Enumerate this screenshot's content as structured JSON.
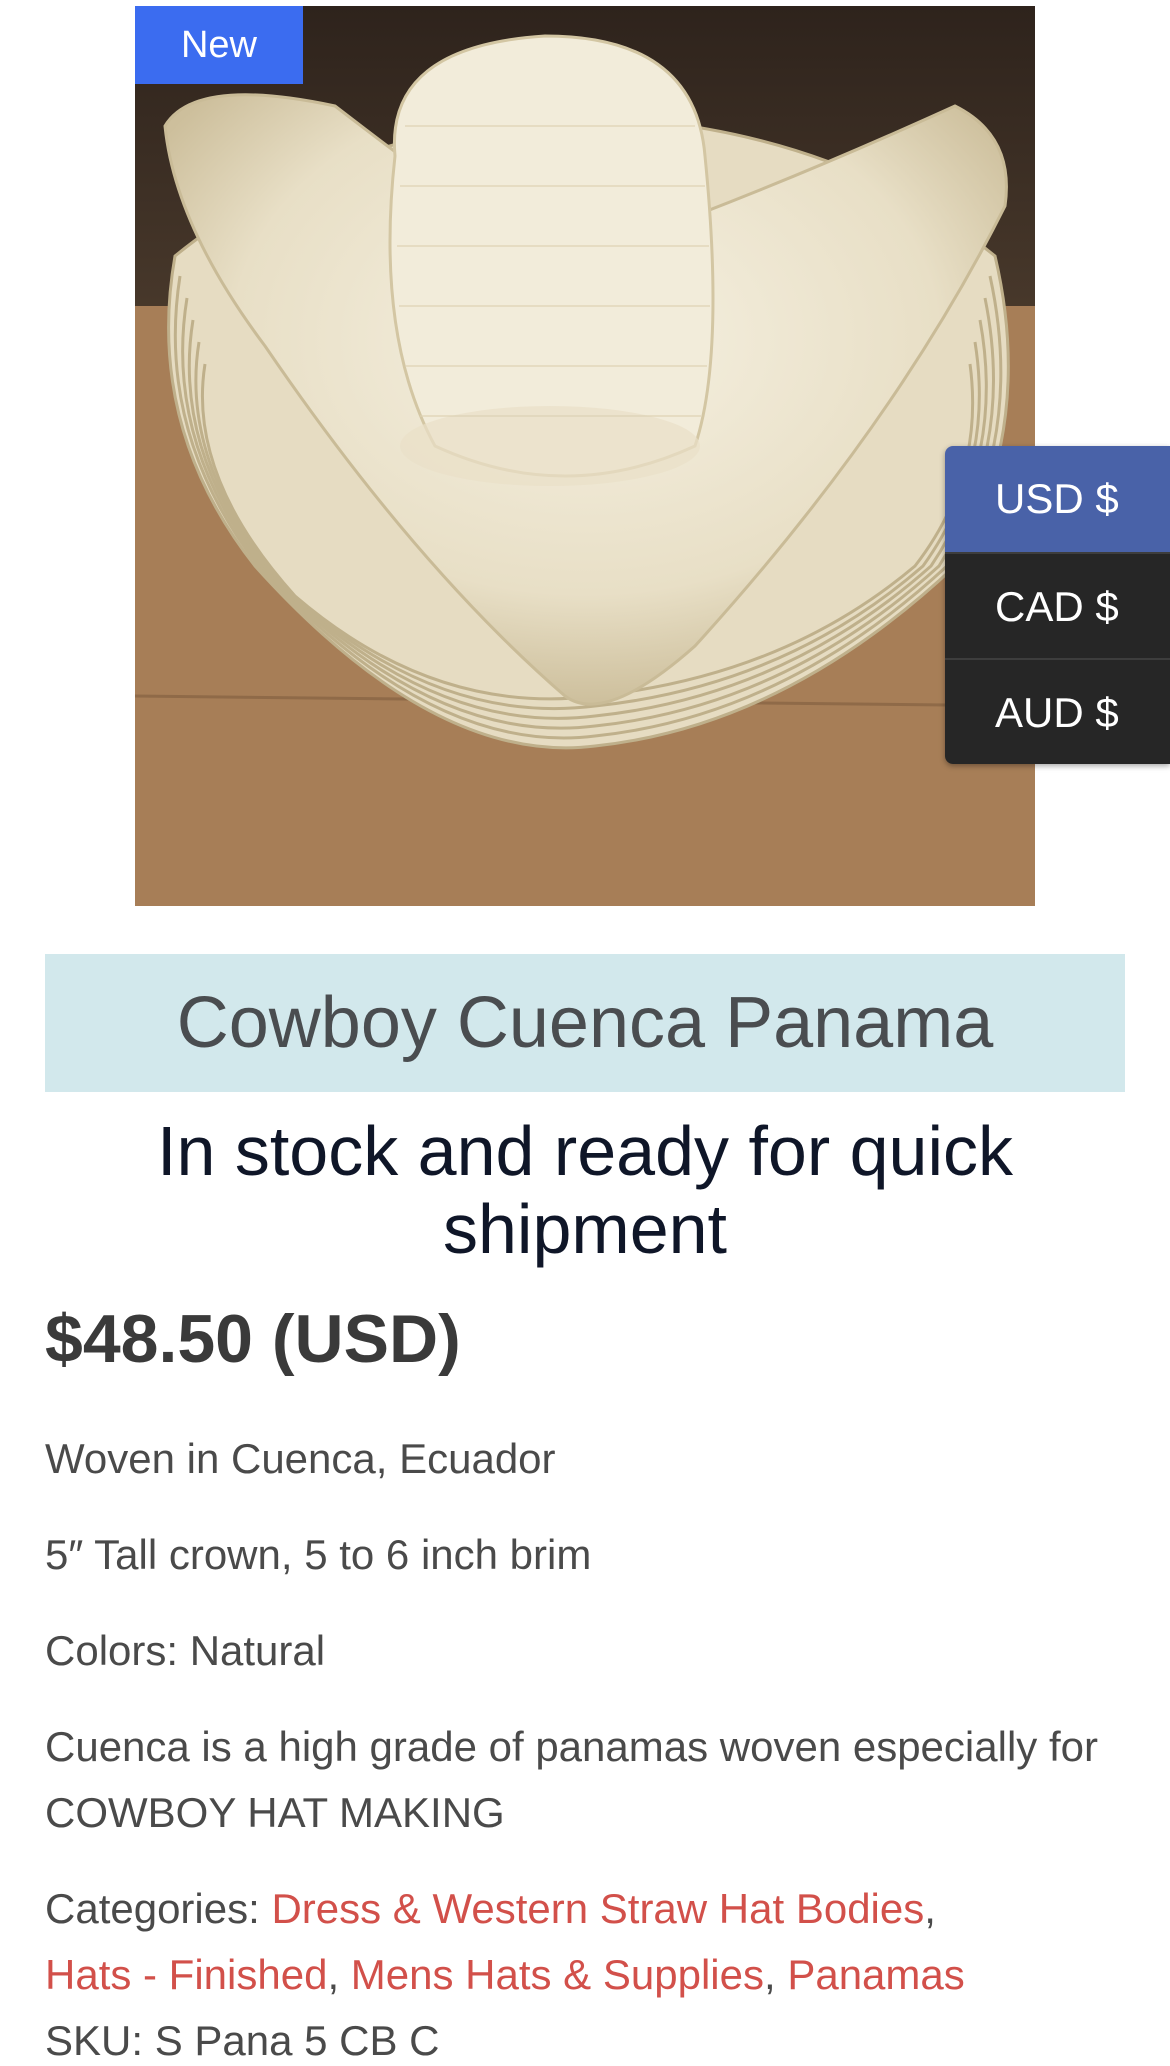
{
  "product": {
    "badge": "New",
    "title": "Cowboy Cuenca Panama",
    "stock_message": "In stock and ready for quick shipment",
    "price": "$48.50 (USD)",
    "description": [
      "Woven in Cuenca, Ecuador",
      "5″ Tall crown, 5 to 6 inch brim",
      "Colors: Natural",
      "Cuenca is a high grade of panamas woven especially for COWBOY HAT MAKING"
    ],
    "categories_label": "Categories:",
    "categories": [
      "Dress & Western Straw Hat Bodies",
      "Hats - Finished",
      "Mens Hats & Supplies",
      "Panamas"
    ],
    "category_separator": ",",
    "sku_label": "SKU:",
    "sku": "S Pana 5 CB C"
  },
  "currency_switcher": {
    "options": [
      "USD $",
      "CAD $",
      "AUD $"
    ],
    "selected": "USD $"
  },
  "colors": {
    "badge": "#3b6cf0",
    "currency_active": "#4962a8",
    "currency_bg": "#262626",
    "title_band": "#d2e8ec",
    "link": "#d2504a"
  },
  "icons": {
    "product_image": "straw-hat-stack-photo"
  }
}
